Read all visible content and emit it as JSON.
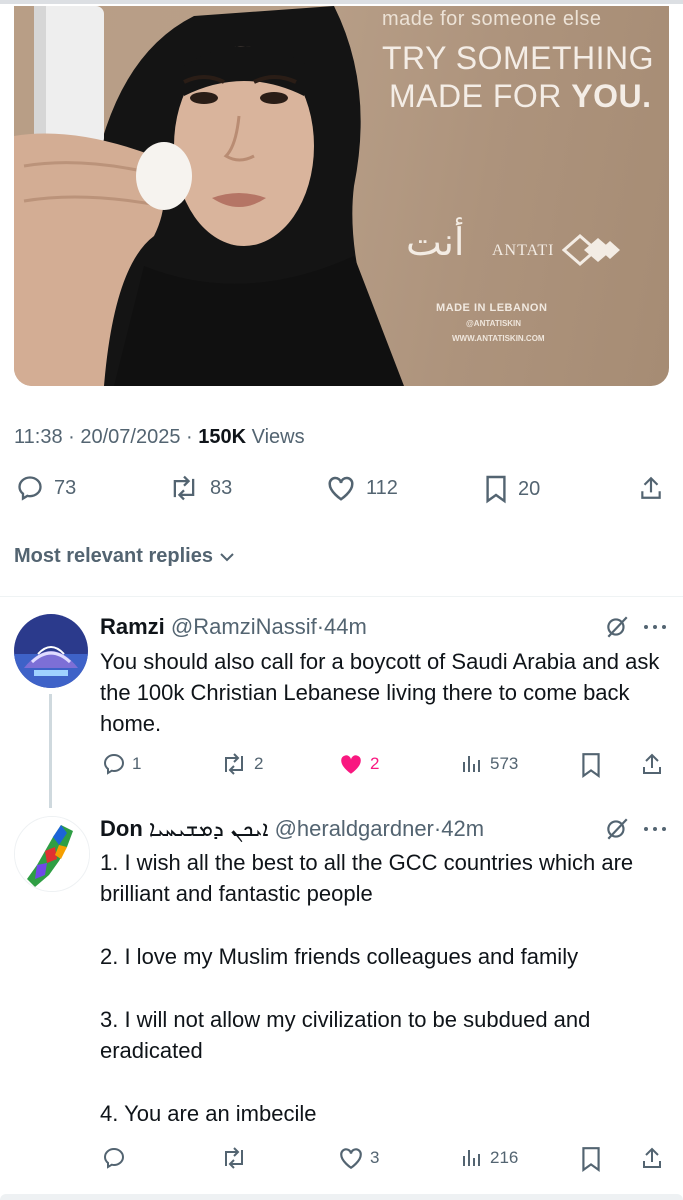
{
  "ad": {
    "line1": "made for someone else",
    "line2": "TRY SOMETHING",
    "line3_prefix": "MADE FOR ",
    "line3_bold": "YOU.",
    "arabic_brand": "أنت",
    "brand": "ANTATI",
    "made_in": "MADE IN LEBANON",
    "handle": "@ANTATISKIN",
    "website": "WWW.ANTATISKIN.COM"
  },
  "post": {
    "time": "11:38",
    "date": "20/07/2025",
    "views_count": "150K",
    "views_label": "Views",
    "replies": "73",
    "reposts": "83",
    "likes": "112",
    "bookmarks": "20"
  },
  "sort_label": "Most relevant replies",
  "replies": [
    {
      "name": "Ramzi",
      "handle": "@RamziNassif",
      "time": "44m",
      "text": "You should also call for a boycott of Saudi Arabia and ask the 100k Christian Lebanese living there to come back home.",
      "replies": "1",
      "reposts": "2",
      "likes": "2",
      "views": "573"
    },
    {
      "name": "Don",
      "name_extra": "ܐܝܟܢ ܕܡܫܝܚܝܐ",
      "handle": "@heraldgardner",
      "time": "42m",
      "paragraphs": [
        "1. I wish all the best to all the GCC countries which are brilliant and fantastic people",
        "2. I love my Muslim friends colleagues and family",
        "3. I will not allow my civilization to be subdued and eradicated",
        "4. You are an imbecile"
      ],
      "likes": "3",
      "views": "216"
    }
  ],
  "colors": {
    "muted": "#536471",
    "text": "#0f1419",
    "like": "#f91880"
  }
}
